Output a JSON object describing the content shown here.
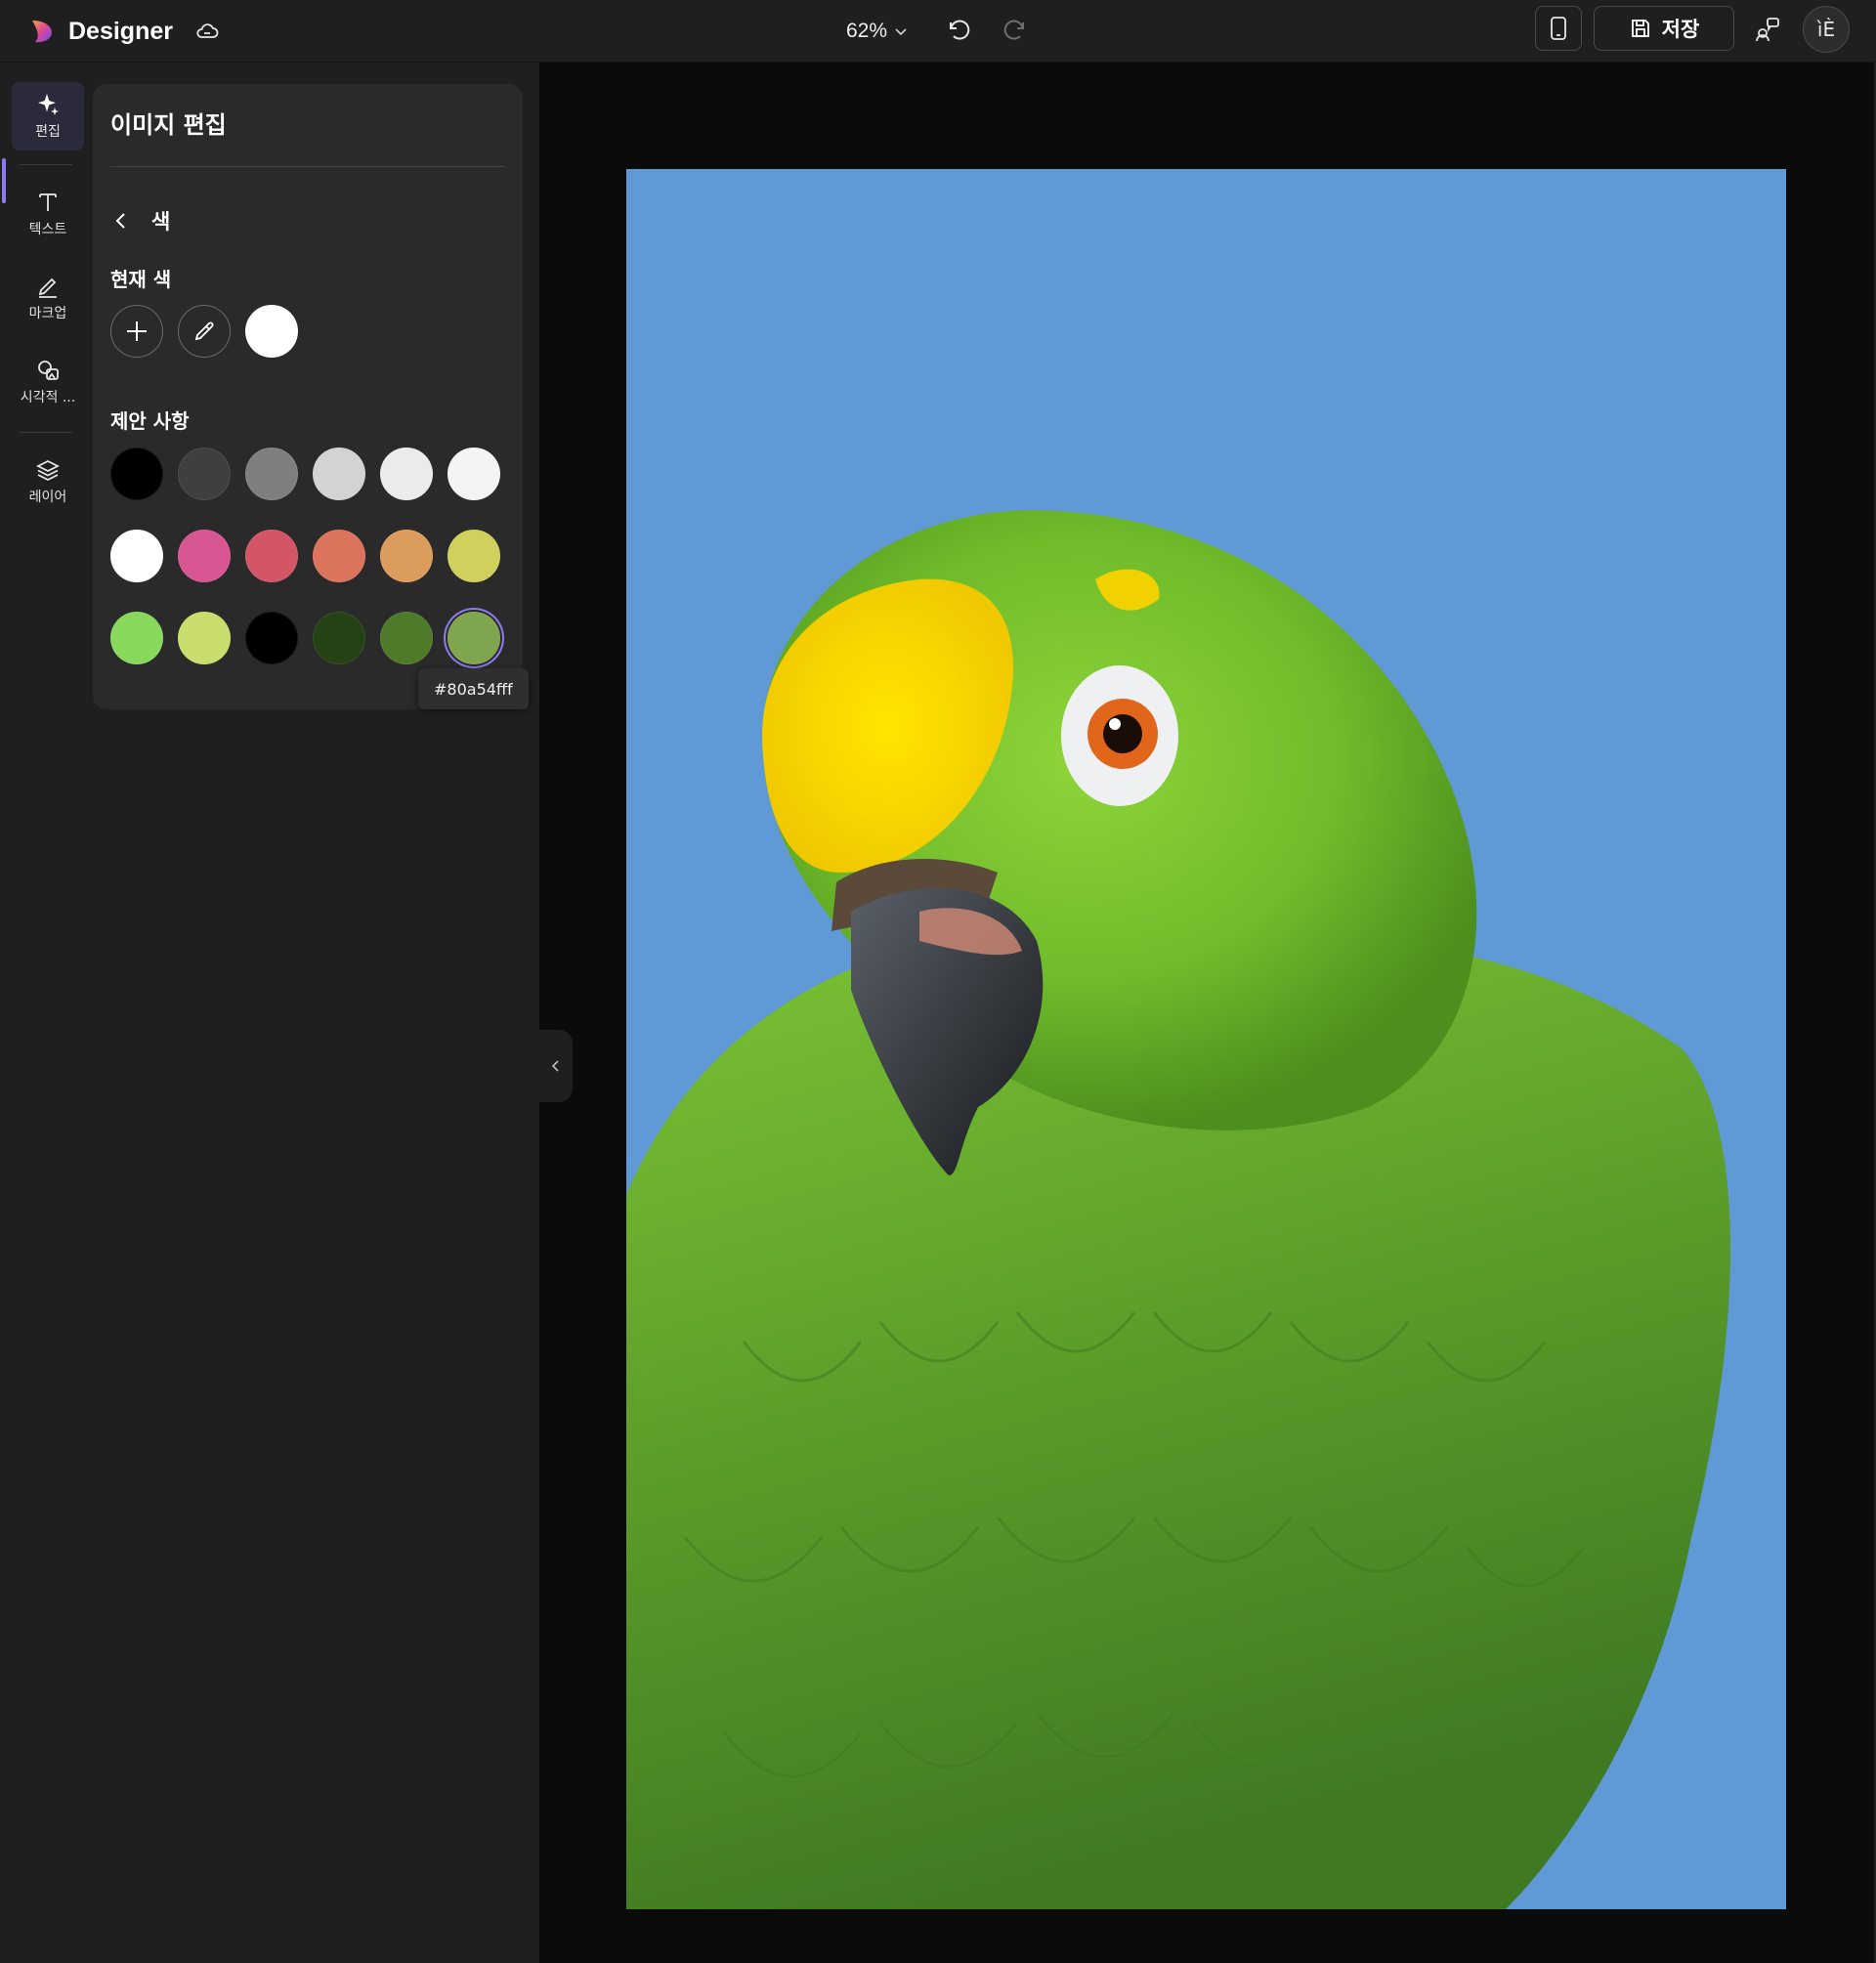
{
  "header": {
    "app_name": "Designer",
    "zoom_label": "62%",
    "save_label": "저장",
    "avatar_initials": "ìÈ"
  },
  "rail": {
    "items": [
      {
        "label": "편집",
        "icon": "sparkle-icon"
      },
      {
        "label": "텍스트",
        "icon": "text-icon"
      },
      {
        "label": "마크업",
        "icon": "pen-icon"
      },
      {
        "label": "시각적 ...",
        "icon": "shapes-icon"
      },
      {
        "label": "레이어",
        "icon": "layers-icon"
      }
    ]
  },
  "panel": {
    "title": "이미지 편집",
    "back_label": "색",
    "current_color_label": "현재 색",
    "current_color": "#ffffff",
    "suggestions_label": "제안 사항",
    "suggestions": [
      "#000000",
      "#3f3f3f",
      "#7f7f7f",
      "#d3d3d3",
      "#ebebeb",
      "#f4f4f4",
      "#ffffff",
      "#d75691",
      "#d35566",
      "#dc735c",
      "#dc9d5c",
      "#d0d05c",
      "#88d85c",
      "#c9dd6c",
      "#000000",
      "#254216",
      "#4f7a2a",
      "#80a54f"
    ],
    "selected_index": 17,
    "tooltip": "#80a54fff"
  },
  "canvas": {
    "background_color": "#5f99d6"
  }
}
